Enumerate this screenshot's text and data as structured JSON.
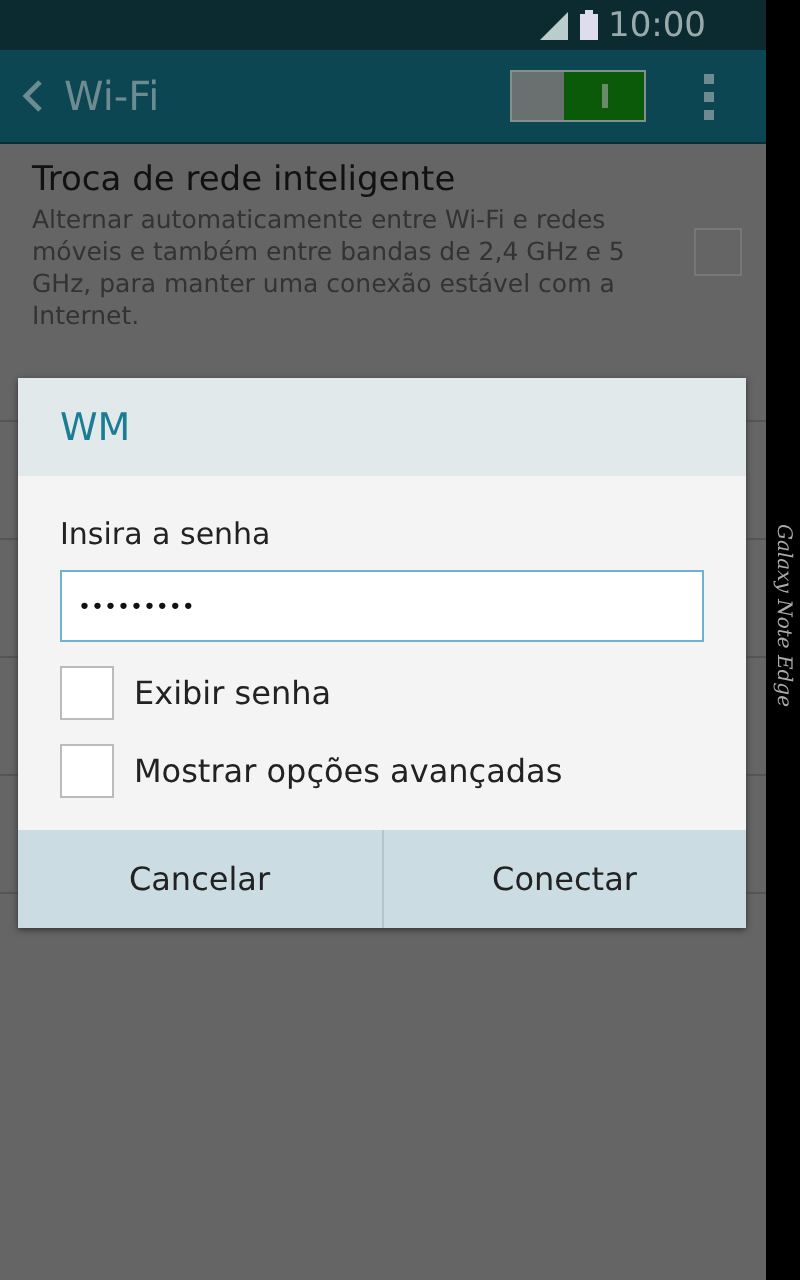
{
  "status_bar": {
    "time": "10:00"
  },
  "action_bar": {
    "title": "Wi-Fi",
    "wifi_on": true
  },
  "smart_switch": {
    "title": "Troca de rede inteligente",
    "description": "Alternar automaticamente entre Wi-Fi e redes móveis e também entre bandas de 2,4 GHz e 5 GHz, para manter uma conexão estável com a Internet.",
    "checked": false
  },
  "dialog": {
    "title": "WM",
    "label": "Insira a senha",
    "password": "•••••••••",
    "options": [
      {
        "label": "Exibir senha",
        "checked": false
      },
      {
        "label": "Mostrar opções avançadas",
        "checked": false
      }
    ],
    "buttons": [
      "Cancelar",
      "Conectar"
    ]
  },
  "edge_label": "Galaxy Note Edge"
}
